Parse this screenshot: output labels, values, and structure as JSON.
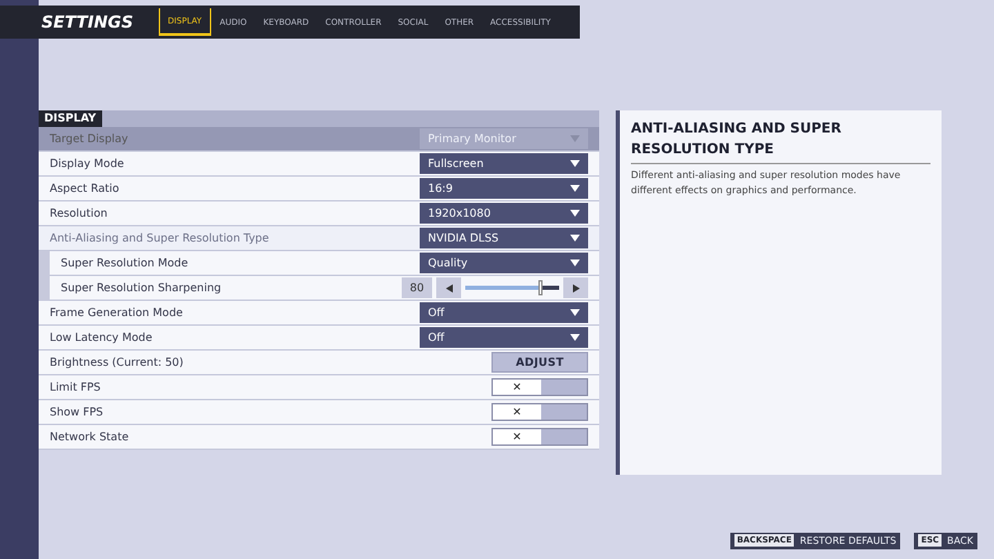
{
  "header": {
    "title": "SETTINGS"
  },
  "tabs": [
    {
      "label": "DISPLAY",
      "selected": true
    },
    {
      "label": "AUDIO",
      "selected": false
    },
    {
      "label": "KEYBOARD",
      "selected": false
    },
    {
      "label": "CONTROLLER",
      "selected": false
    },
    {
      "label": "SOCIAL",
      "selected": false
    },
    {
      "label": "OTHER",
      "selected": false
    },
    {
      "label": "ACCESSIBILITY",
      "selected": false
    }
  ],
  "section": {
    "title": "DISPLAY"
  },
  "settings": [
    {
      "kind": "dropdown",
      "label": "Target Display",
      "value": "Primary Monitor",
      "disabled": true,
      "selected": false
    },
    {
      "kind": "dropdown",
      "label": "Display Mode",
      "value": "Fullscreen",
      "disabled": false,
      "selected": false
    },
    {
      "kind": "dropdown",
      "label": "Aspect Ratio",
      "value": "16:9",
      "disabled": false,
      "selected": false
    },
    {
      "kind": "dropdown",
      "label": "Resolution",
      "value": "1920x1080",
      "disabled": false,
      "selected": false
    },
    {
      "kind": "dropdown",
      "label": "Anti-Aliasing and Super Resolution Type",
      "value": "NVIDIA DLSS",
      "disabled": false,
      "selected": true,
      "children": [
        {
          "kind": "dropdown",
          "label": "Super Resolution Mode",
          "value": "Quality",
          "disabled": false,
          "selected": false
        },
        {
          "kind": "slider",
          "label": "Super Resolution Sharpening",
          "value": "80",
          "level": 0.8,
          "selected": false
        }
      ]
    },
    {
      "kind": "dropdown",
      "label": "Frame Generation Mode",
      "value": "Off",
      "disabled": false,
      "selected": false
    },
    {
      "kind": "dropdown",
      "label": "Low Latency Mode",
      "value": "Off",
      "disabled": false,
      "selected": false
    },
    {
      "kind": "button",
      "label": "Brightness (Current: 50)",
      "value": "ADJUST",
      "selected": false
    },
    {
      "kind": "toggle",
      "label": "Limit FPS",
      "value": "✕",
      "on": false,
      "selected": false
    },
    {
      "kind": "toggle",
      "label": "Show FPS",
      "value": "✕",
      "on": false,
      "selected": false
    },
    {
      "kind": "toggle",
      "label": "Network State",
      "value": "✕",
      "on": false,
      "selected": false
    }
  ],
  "info": {
    "title": "ANTI-ALIASING AND SUPER RESOLUTION TYPE",
    "text": "Different anti-aliasing and super resolution modes have different effects on graphics and performance."
  },
  "footer": [
    {
      "key": "BACKSPACE",
      "label": "RESTORE DEFAULTS"
    },
    {
      "key": "ESC",
      "label": "BACK"
    }
  ]
}
